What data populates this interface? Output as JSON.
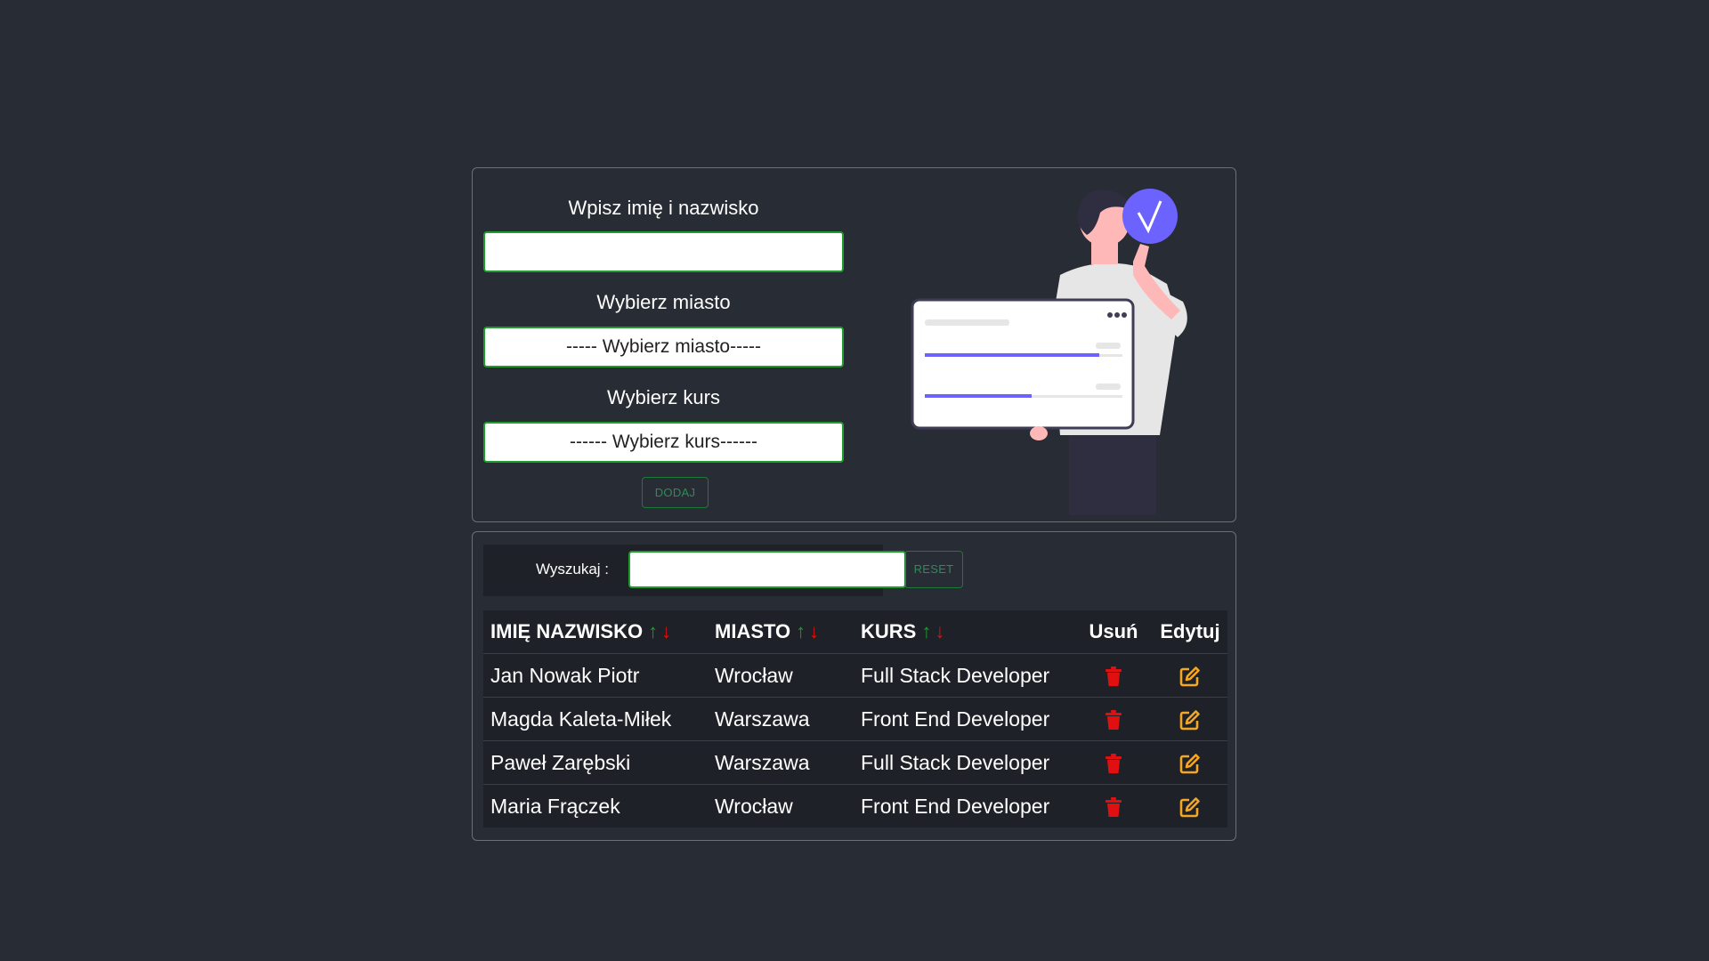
{
  "form": {
    "name_label": "Wpisz imię i nazwisko",
    "name_value": "",
    "city_label": "Wybierz miasto",
    "city_select": "----- Wybierz miasto-----",
    "course_label": "Wybierz kurs",
    "course_select": "------ Wybierz kurs------",
    "add_button": "DODAJ"
  },
  "search": {
    "label": "Wyszukaj :",
    "value": "",
    "reset_button": "RESET"
  },
  "table": {
    "headers": {
      "name": "IMIĘ NAZWISKO",
      "city": "MIASTO",
      "course": "KURS",
      "delete": "Usuń",
      "edit": "Edytuj"
    },
    "sort_up": "↑",
    "sort_down": "↓",
    "rows": [
      {
        "name": "Jan Nowak Piotr",
        "city": "Wrocław",
        "course": "Full Stack Developer"
      },
      {
        "name": "Magda Kaleta-Miłek",
        "city": "Warszawa",
        "course": "Front End Developer"
      },
      {
        "name": "Paweł Zarębski",
        "city": "Warszawa",
        "course": "Full Stack Developer"
      },
      {
        "name": "Maria Frączek",
        "city": "Wrocław",
        "course": "Front End Developer"
      }
    ]
  },
  "icons": {
    "delete": "trash-icon",
    "edit": "edit-icon"
  },
  "colors": {
    "background": "#282c34",
    "accent_green": "#1f9d2c",
    "delete_red": "#e01010",
    "edit_orange": "#f5a623",
    "illustration_purple": "#6c63ff"
  }
}
